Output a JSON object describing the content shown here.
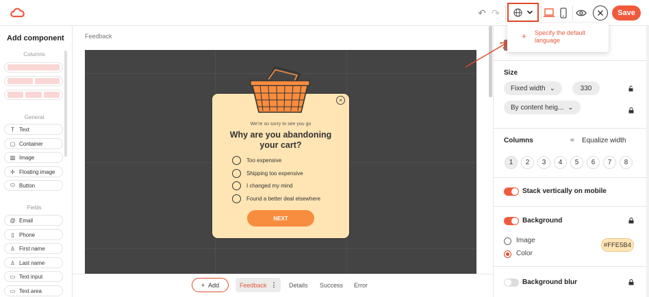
{
  "topbar": {
    "logo_icon": "cloud-logo-icon",
    "undo_icon": "undo-icon",
    "redo_icon": "redo-icon",
    "language_icon": "globe-icon",
    "language_dropdown_icon": "chevron-down-icon",
    "desktop_icon": "laptop-icon",
    "mobile_icon": "phone-icon",
    "preview_icon": "eye-icon",
    "close_icon": "close-icon",
    "save_label": "Save",
    "accent_color": "#f05a3c"
  },
  "language_popover": {
    "add_label": "+",
    "text": "Specify the default language"
  },
  "left_panel": {
    "title": "Add component",
    "columns_section": "Columns",
    "general_section": "General",
    "general_items": [
      {
        "label": "Text",
        "icon": "T"
      },
      {
        "label": "Container",
        "icon": "▢"
      },
      {
        "label": "Image",
        "icon": "▧"
      },
      {
        "label": "Floating image",
        "icon": "✢"
      },
      {
        "label": "Button",
        "icon": "⬭"
      }
    ],
    "fields_section": "Fields",
    "field_items": [
      {
        "label": "Email",
        "icon": "@"
      },
      {
        "label": "Phone",
        "icon": "▯"
      },
      {
        "label": "First name",
        "icon": "♙"
      },
      {
        "label": "Last name",
        "icon": "♙"
      },
      {
        "label": "Text input",
        "icon": "▭"
      },
      {
        "label": "Text area",
        "icon": "▭"
      }
    ]
  },
  "canvas": {
    "breadcrumb": "Feedback",
    "popup": {
      "subtitle": "We're so sorry to see you go",
      "heading": "Why are you abandoning your cart?",
      "options": [
        "Too expensive",
        "Shipping too expensive",
        "I changed my mind",
        "Found a better deal elsewhere"
      ],
      "next_label": "NEXT",
      "close_glyph": "✕",
      "background_color": "#ffe5b4",
      "button_color": "#f98d3f"
    }
  },
  "bottom_bar": {
    "add_label": "Add",
    "tabs": [
      "Feedback",
      "Details",
      "Success",
      "Error"
    ],
    "active_tab": "Feedback"
  },
  "right_panel": {
    "size_label": "Size",
    "width_mode": "Fixed width",
    "width_value": "330",
    "height_mode": "By content heig...",
    "columns_label": "Columns",
    "equalize_label": "Equalize width",
    "equalize_symbol": "=",
    "column_counts": [
      "1",
      "2",
      "3",
      "4",
      "5",
      "6",
      "7",
      "8"
    ],
    "selected_column_count": "1",
    "stack_label": "Stack vertically on mobile",
    "stack_on": true,
    "background_label": "Background",
    "background_on": true,
    "bg_image_label": "Image",
    "bg_color_label": "Color",
    "bg_selected": "Color",
    "bg_color_value": "#FFE5B4",
    "blur_label": "Background blur",
    "blur_on": false
  }
}
